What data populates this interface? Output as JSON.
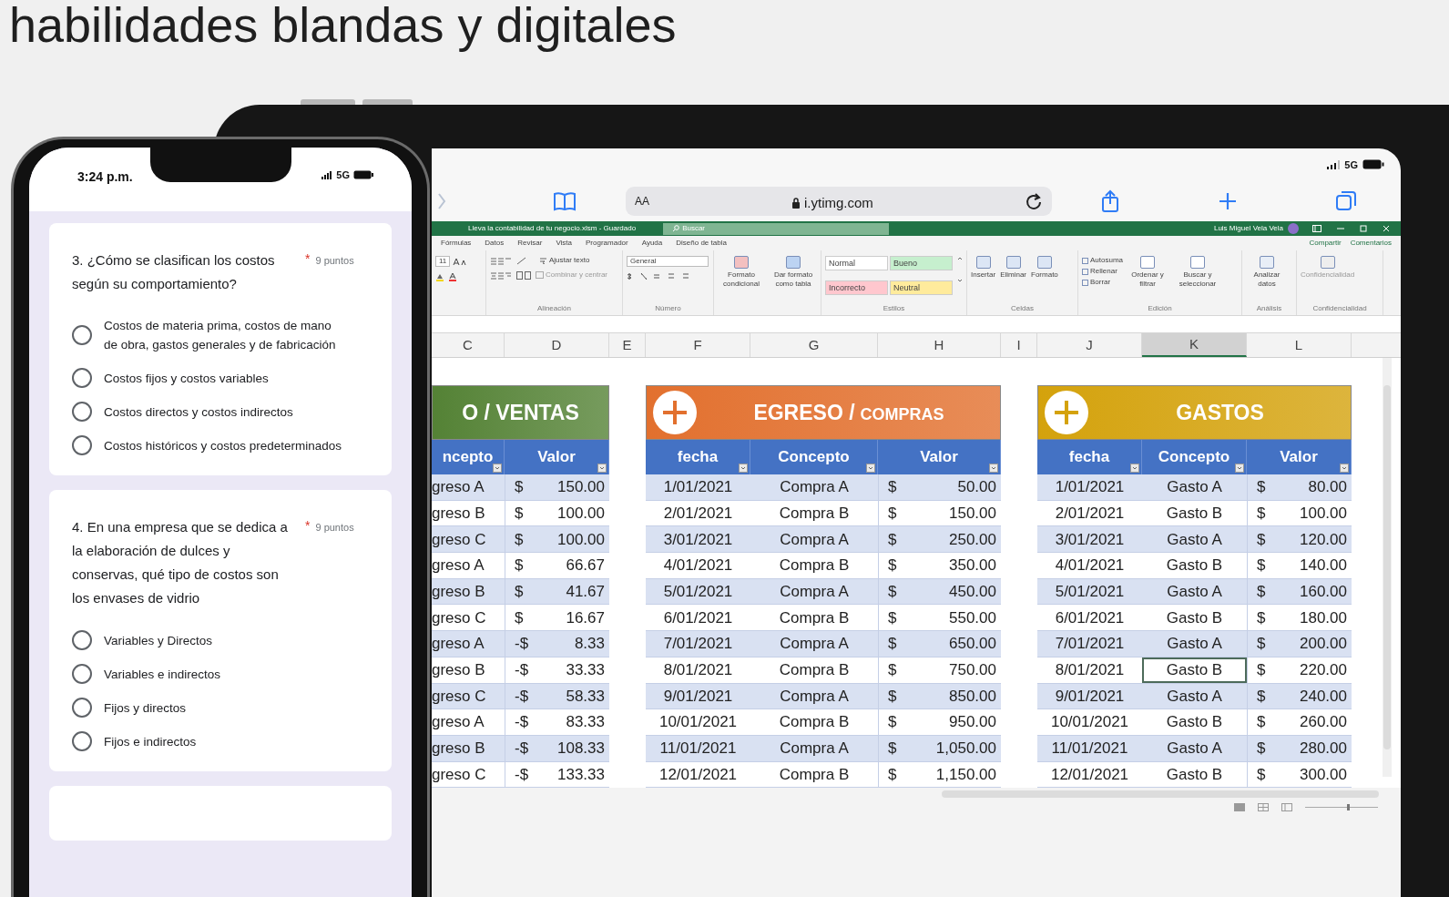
{
  "heading": "habilidades blandas y digitales",
  "phone": {
    "time": "3:24 p.m.",
    "network": "5G",
    "questions": [
      {
        "text": "3. ¿Cómo se clasifican los costos según su comportamiento?",
        "required_mark": "*",
        "points": "9 puntos",
        "options": [
          {
            "label": "Costos de materia prima, costos de mano de obra, gastos generales y de fabricación",
            "selected": false
          },
          {
            "label": "Costos fijos y costos variables",
            "selected": false
          },
          {
            "label": "Costos directos y costos indirectos",
            "selected": false
          },
          {
            "label": "Costos históricos y costos predeterminados",
            "selected": false
          }
        ]
      },
      {
        "text": "4. En una empresa que se dedica a la elaboración de dulces y conservas, qué tipo de costos son los envases de vidrio",
        "required_mark": "*",
        "points": "9 puntos",
        "options": [
          {
            "label": "Variables y Directos",
            "selected": false
          },
          {
            "label": "Variables e indirectos",
            "selected": false
          },
          {
            "label": "Fijos y directos",
            "selected": false
          },
          {
            "label": "Fijos e indirectos",
            "selected": false
          }
        ]
      }
    ]
  },
  "tablet": {
    "network": "5G",
    "text_size_button": "AA",
    "address": "i.ytimg.com"
  },
  "excel": {
    "title": "Lleva la contabilidad de tu negocio.xlsm - Guardado",
    "search": "Buscar",
    "user": "Luis Miguel Vela Vela",
    "ribbon_tabs": [
      "Fórmulas",
      "Datos",
      "Revisar",
      "Vista",
      "Programador",
      "Ayuda",
      "Diseño de tabla"
    ],
    "share": "Compartir",
    "comments": "Comentarios",
    "font_size": "11",
    "wrap_text": "Ajustar texto",
    "merge": "Combinar y centrar",
    "number_format": "General",
    "conditional_format": "Formato condicional",
    "format_as_table": "Dar formato como tabla",
    "styles": [
      {
        "label": "Normal",
        "color": "#ffffff"
      },
      {
        "label": "Bueno",
        "color": "#c6efce"
      },
      {
        "label": "Incorrecto",
        "color": "#ffc7ce"
      },
      {
        "label": "Neutral",
        "color": "#ffeb9c"
      }
    ],
    "cell_commands": [
      "Insertar",
      "Eliminar",
      "Formato"
    ],
    "edit_commands": [
      "Autosuma",
      "Rellenar",
      "Borrar"
    ],
    "sort_filter": "Ordenar y filtrar",
    "find_select": "Buscar y seleccionar",
    "analyze": "Analizar datos",
    "sensitivity": "Confidencialidad",
    "group_labels": [
      "Alineación",
      "Número",
      "Estilos",
      "Celdas",
      "Edición",
      "Análisis",
      "Confidencialidad"
    ],
    "zoom": {
      "level": 0.6
    },
    "column_headers": [
      {
        "label": "C",
        "selected": false
      },
      {
        "label": "D",
        "selected": false
      },
      {
        "label": "E",
        "selected": false
      },
      {
        "label": "F",
        "selected": false
      },
      {
        "label": "G",
        "selected": false
      },
      {
        "label": "H",
        "selected": false
      },
      {
        "label": "I",
        "selected": false
      },
      {
        "label": "J",
        "selected": false
      },
      {
        "label": "K",
        "selected": true
      },
      {
        "label": "L",
        "selected": false
      }
    ],
    "tables": [
      {
        "title": "O / VENTAS",
        "color": "#548235",
        "columns": [
          {
            "label": "ncepto",
            "kind": "text"
          },
          {
            "label": "Valor",
            "kind": "money"
          }
        ],
        "rows": [
          {
            "cells": [
              "greso A",
              "$",
              "150.00"
            ]
          },
          {
            "cells": [
              "greso B",
              "$",
              "100.00"
            ]
          },
          {
            "cells": [
              "greso C",
              "$",
              "100.00"
            ]
          },
          {
            "cells": [
              "greso A",
              "$",
              "66.67"
            ]
          },
          {
            "cells": [
              "greso B",
              "$",
              "41.67"
            ]
          },
          {
            "cells": [
              "greso C",
              "$",
              "16.67"
            ]
          },
          {
            "cells": [
              "greso A",
              "-$",
              "8.33"
            ]
          },
          {
            "cells": [
              "greso B",
              "-$",
              "33.33"
            ]
          },
          {
            "cells": [
              "greso C",
              "-$",
              "58.33"
            ]
          },
          {
            "cells": [
              "greso A",
              "-$",
              "83.33"
            ]
          },
          {
            "cells": [
              "greso B",
              "-$",
              "108.33"
            ]
          },
          {
            "cells": [
              "greso C",
              "-$",
              "133.33"
            ]
          }
        ]
      },
      {
        "title": "EGRESO /",
        "subtitle": "COMPRAS",
        "plus_icon": true,
        "color": "#e2702e",
        "columns": [
          {
            "label": "fecha",
            "kind": "text"
          },
          {
            "label": "Concepto",
            "kind": "text"
          },
          {
            "label": "Valor",
            "kind": "money"
          }
        ],
        "rows": [
          {
            "cells": [
              "1/01/2021",
              "Compra A",
              "$",
              "50.00"
            ]
          },
          {
            "cells": [
              "2/01/2021",
              "Compra B",
              "$",
              "150.00"
            ]
          },
          {
            "cells": [
              "3/01/2021",
              "Compra A",
              "$",
              "250.00"
            ]
          },
          {
            "cells": [
              "4/01/2021",
              "Compra B",
              "$",
              "350.00"
            ]
          },
          {
            "cells": [
              "5/01/2021",
              "Compra A",
              "$",
              "450.00"
            ]
          },
          {
            "cells": [
              "6/01/2021",
              "Compra B",
              "$",
              "550.00"
            ]
          },
          {
            "cells": [
              "7/01/2021",
              "Compra A",
              "$",
              "650.00"
            ]
          },
          {
            "cells": [
              "8/01/2021",
              "Compra B",
              "$",
              "750.00"
            ]
          },
          {
            "cells": [
              "9/01/2021",
              "Compra A",
              "$",
              "850.00"
            ]
          },
          {
            "cells": [
              "10/01/2021",
              "Compra B",
              "$",
              "950.00"
            ]
          },
          {
            "cells": [
              "11/01/2021",
              "Compra A",
              "$",
              "1,050.00"
            ]
          },
          {
            "cells": [
              "12/01/2021",
              "Compra B",
              "$",
              "1,150.00"
            ]
          }
        ]
      },
      {
        "title": "GASTOS",
        "plus_icon": true,
        "color": "#d4a20c",
        "columns": [
          {
            "label": "fecha",
            "kind": "text"
          },
          {
            "label": "Concepto",
            "kind": "text"
          },
          {
            "label": "Valor",
            "kind": "money"
          }
        ],
        "rows": [
          {
            "cells": [
              "1/01/2021",
              "Gasto A",
              "$",
              "80.00"
            ],
            "selected": false
          },
          {
            "cells": [
              "2/01/2021",
              "Gasto B",
              "$",
              "100.00"
            ],
            "selected": false
          },
          {
            "cells": [
              "3/01/2021",
              "Gasto A",
              "$",
              "120.00"
            ],
            "selected": false
          },
          {
            "cells": [
              "4/01/2021",
              "Gasto B",
              "$",
              "140.00"
            ],
            "selected": false
          },
          {
            "cells": [
              "5/01/2021",
              "Gasto A",
              "$",
              "160.00"
            ],
            "selected": false
          },
          {
            "cells": [
              "6/01/2021",
              "Gasto B",
              "$",
              "180.00"
            ],
            "selected": false
          },
          {
            "cells": [
              "7/01/2021",
              "Gasto A",
              "$",
              "200.00"
            ],
            "selected": false
          },
          {
            "cells": [
              "8/01/2021",
              "Gasto B",
              "$",
              "220.00"
            ],
            "selected": true
          },
          {
            "cells": [
              "9/01/2021",
              "Gasto A",
              "$",
              "240.00"
            ],
            "selected": false
          },
          {
            "cells": [
              "10/01/2021",
              "Gasto B",
              "$",
              "260.00"
            ],
            "selected": false
          },
          {
            "cells": [
              "11/01/2021",
              "Gasto A",
              "$",
              "280.00"
            ],
            "selected": false
          },
          {
            "cells": [
              "12/01/2021",
              "Gasto B",
              "$",
              "300.00"
            ],
            "selected": false
          }
        ]
      }
    ]
  }
}
